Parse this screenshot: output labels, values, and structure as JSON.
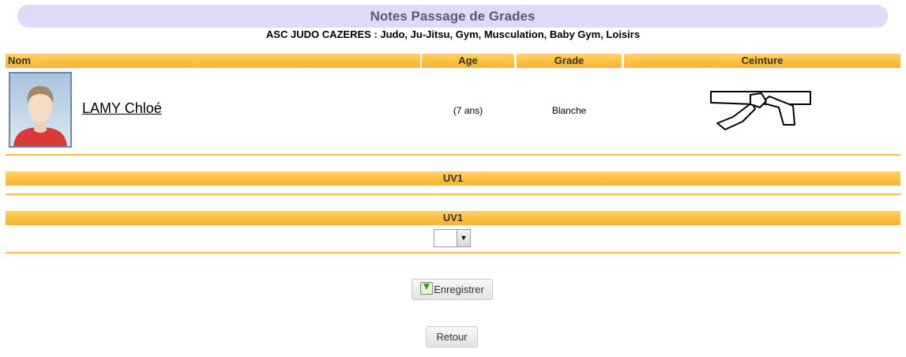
{
  "page": {
    "title": "Notes Passage de Grades",
    "club": "ASC JUDO CAZERES : Judo, Ju-Jitsu, Gym, Musculation, Baby Gym, Loisirs"
  },
  "table": {
    "headers": {
      "name": "Nom",
      "age": "Age",
      "grade": "Grade",
      "belt": "Ceinture"
    },
    "student": {
      "name": "LAMY Chloé",
      "age": "(7 ans)",
      "grade": "Blanche",
      "belt_icon": "white-belt-icon"
    }
  },
  "sections": [
    {
      "label": "UV1"
    },
    {
      "label": "UV1",
      "select_value": ""
    }
  ],
  "buttons": {
    "save": "Enregistrer",
    "back": "Retour"
  },
  "colors": {
    "header_orange": "#fcbf3c",
    "title_bar": "#dcdcf8",
    "title_text": "#5c5c6e"
  }
}
